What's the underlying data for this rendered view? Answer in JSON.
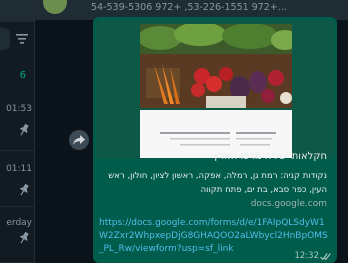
{
  "header": {
    "phone_numbers": "54-539-5306 972+ ,53-226-1551 972+..."
  },
  "chat_list": {
    "unread_count": "6",
    "rows": [
      {
        "time": "01:53"
      },
      {
        "time": "01:11"
      },
      {
        "time": "erday"
      }
    ]
  },
  "message": {
    "link_preview": {
      "title": "חקלאות ישירה מרכז הארץ",
      "description": "נקודות קניה: רמת גן, רמלה, אפקה, ראשון לציון, חולון, ראש העין, כפר סבא, בת ים, פתח תקווה",
      "domain": "docs.google.com"
    },
    "url": "https://docs.google.com/forms/d/e/1FAIpQLSdyW1W2Zxr2WhpxepDjG8GHAQOO2aLWbycl2HnBpOMS_PL_Rw/viewform?usp=sf_link",
    "time": "12:32"
  },
  "colors": {
    "outgoing_bubble": "#005c4b",
    "link": "#53bdeb",
    "accent": "#00a884"
  }
}
